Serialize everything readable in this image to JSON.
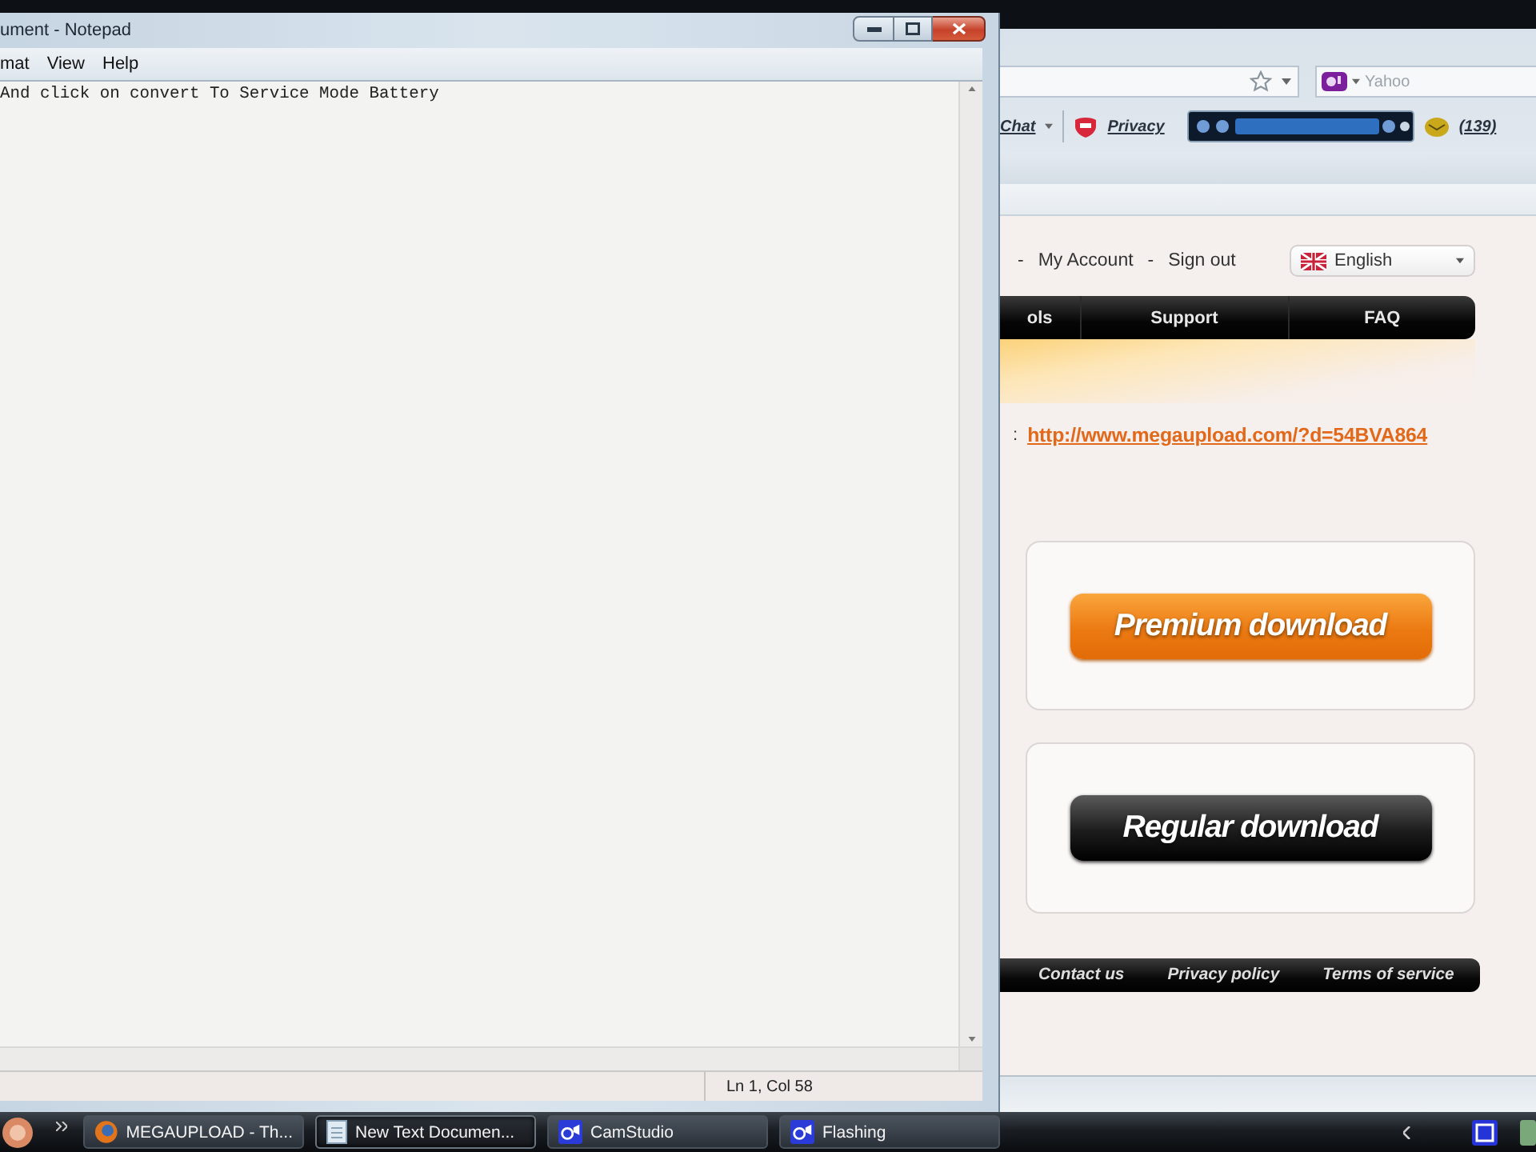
{
  "notepad": {
    "title": "ument - Notepad",
    "menu": [
      "mat",
      "View",
      "Help"
    ],
    "text": "And click on convert To Service Mode Battery",
    "status": "Ln 1, Col 58"
  },
  "browser": {
    "search": {
      "placeholder": "Yahoo"
    },
    "toolbar": {
      "chat": "Chat",
      "privacy": "Privacy",
      "mail_count": "(139)"
    }
  },
  "page": {
    "separator": "-",
    "account_links": [
      "My Account",
      "Sign out"
    ],
    "language": "English",
    "nav": [
      "ols",
      "Support",
      "FAQ"
    ],
    "link_label": ":",
    "link": "http://www.megaupload.com/?d=54BVA864",
    "downloads": [
      {
        "kind": "premium",
        "label": "Premium download"
      },
      {
        "kind": "regular",
        "label": "Regular download"
      }
    ],
    "footer": [
      "Contact us",
      "Privacy policy",
      "Terms of service"
    ]
  },
  "taskbar": {
    "items": [
      {
        "kind": "browser",
        "label": "MEGAUPLOAD - Th...",
        "selected": false
      },
      {
        "kind": "notepad",
        "label": "New Text Documen...",
        "selected": true
      },
      {
        "kind": "recorder",
        "label": "CamStudio",
        "selected": false
      },
      {
        "kind": "recorder",
        "label": "Flashing",
        "selected": false
      }
    ]
  }
}
